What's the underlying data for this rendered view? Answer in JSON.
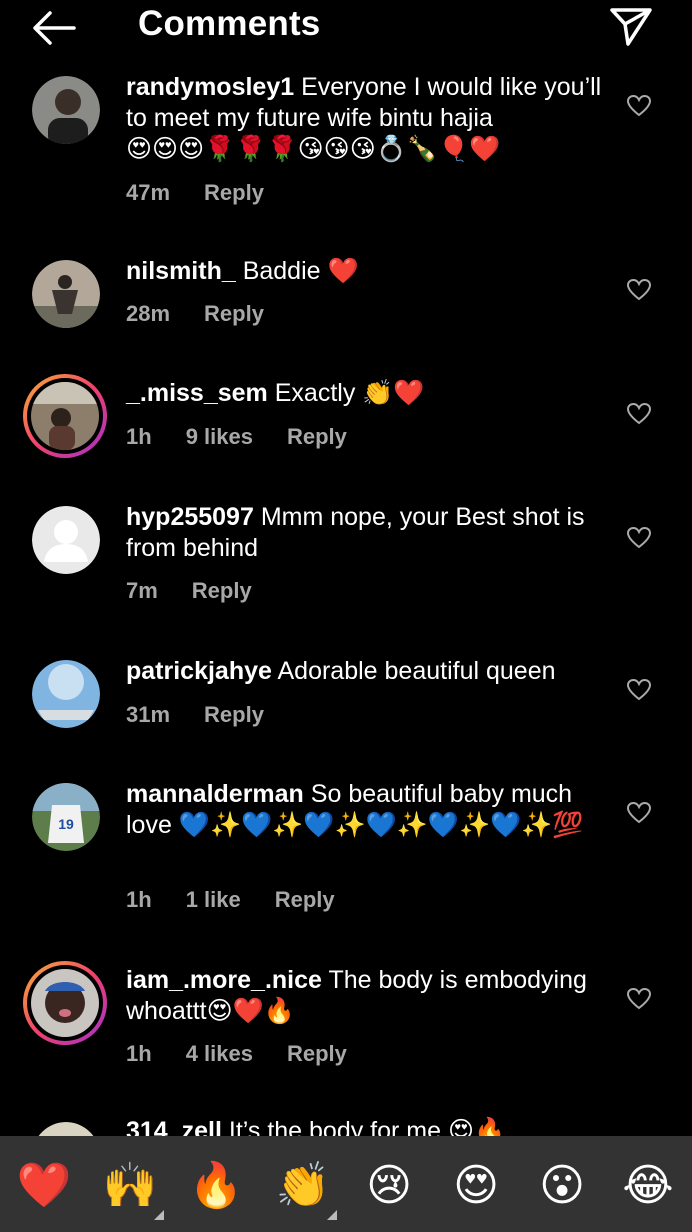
{
  "header": {
    "title": "Comments"
  },
  "comments": [
    {
      "username": "randymosley1",
      "text": "Everyone I would like you’ll to meet my future wife bintu hajia",
      "emojis": "😍😍😍🌹🌹🌹😘😘😘💍🍾🎈❤️",
      "time": "47m",
      "likes": "",
      "reply": "Reply"
    },
    {
      "username": "nilsmith_",
      "text": "Baddie",
      "emojis": "❤️",
      "time": "28m",
      "likes": "",
      "reply": "Reply"
    },
    {
      "username": "_.miss_sem",
      "text": "Exactly",
      "emojis": "👏❤️",
      "time": "1h",
      "likes": "9 likes",
      "reply": "Reply"
    },
    {
      "username": "hyp255097",
      "text": "Mmm nope, your Best shot is from behind",
      "emojis": "",
      "time": "7m",
      "likes": "",
      "reply": "Reply"
    },
    {
      "username": "patrickjahye",
      "text": "Adorable beautiful queen",
      "emojis": "",
      "time": "31m",
      "likes": "",
      "reply": "Reply"
    },
    {
      "username": "mannalderman",
      "text": "So beautiful baby much love",
      "emojis": "💙✨💙✨💙✨💙✨💙✨💙✨💯",
      "time": "1h",
      "likes": "1 like",
      "reply": "Reply"
    },
    {
      "username": "iam_.more_.nice",
      "text": "The body is embodying whoattt",
      "emojis": "😍❤️🔥",
      "time": "1h",
      "likes": "4 likes",
      "reply": "Reply"
    },
    {
      "username": "314_zell",
      "text": "It’s the body for me",
      "emojis": "😍🔥",
      "time": "",
      "likes": "",
      "reply": ""
    }
  ],
  "emoji_bar": [
    "❤️",
    "🙌",
    "🔥",
    "👏",
    "😢",
    "😍",
    "😮",
    "😂"
  ],
  "colors": {
    "background": "#000000",
    "meta": "#a8a8a8",
    "emoji_bar": "#333333"
  }
}
